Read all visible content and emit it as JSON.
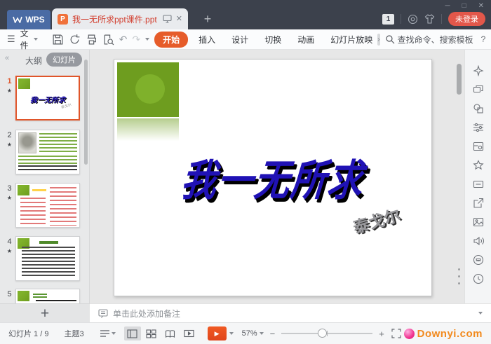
{
  "colors": {
    "accent_orange": "#e65c2a",
    "wps_blue": "#4a6ba4",
    "title_blue": "#2012b5",
    "theme_green": "#6e9d1f",
    "filename_red": "#d23f2f",
    "watermark_orange": "#f28a1e"
  },
  "icons": {
    "hamburger": "☰",
    "collapse": "«",
    "overflow": "›",
    "close": "✕",
    "minimize": "─",
    "maximize": "□",
    "plus": "+",
    "minus": "−",
    "undo": "↶",
    "redo": "↷",
    "play": "▶",
    "star": "★",
    "more": "⋮",
    "help": "?"
  },
  "titlebar": {
    "wps_label": "WPS",
    "tab_title": "我一无所求ppt课件.ppt",
    "file_icon": "P",
    "notification_count": "1",
    "login_label": "未登录"
  },
  "ribbon": {
    "file_label": "文件",
    "tabs": {
      "home": "开始",
      "insert": "插入",
      "design": "设计",
      "transition": "切换",
      "animation": "动画",
      "slideshow": "幻灯片放映"
    },
    "search_label": "查找命令、搜索模板"
  },
  "sidebar": {
    "outline_label": "大纲",
    "slides_label": "幻灯片",
    "slides": [
      {
        "num": "1"
      },
      {
        "num": "2"
      },
      {
        "num": "3"
      },
      {
        "num": "4"
      },
      {
        "num": "5"
      }
    ]
  },
  "slide": {
    "title": "我一无所求",
    "author": "泰戈尔"
  },
  "notes": {
    "placeholder": "单击此处添加备注"
  },
  "statusbar": {
    "slide_counter": "幻灯片 1 / 9",
    "theme_label": "主题3",
    "zoom_value": "57%"
  },
  "watermark": {
    "text": "Downyi.com"
  }
}
